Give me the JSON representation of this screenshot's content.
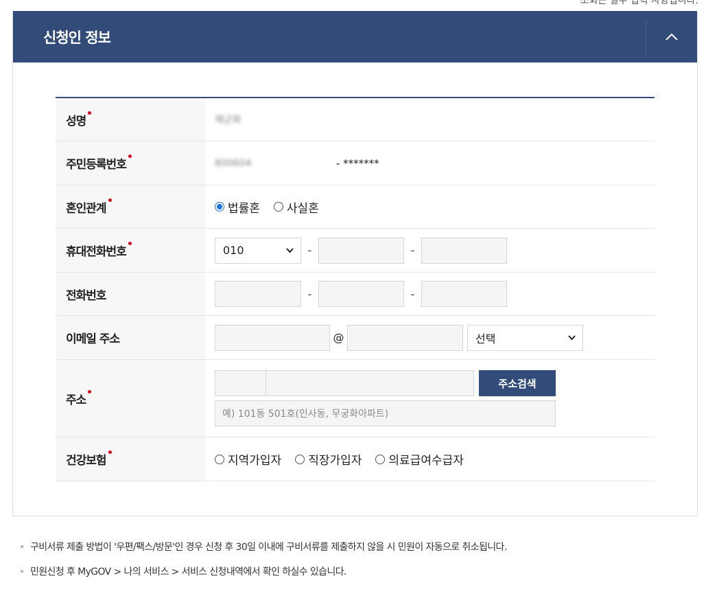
{
  "top_note": "조회는 필수 입력 사항입니다.",
  "section": {
    "title": "신청인 정보"
  },
  "fields": {
    "name": {
      "label": "성명",
      "value": "채군화"
    },
    "rrn": {
      "label": "주민등록번호",
      "front": "800604",
      "back": "- *******"
    },
    "marriage": {
      "label": "혼인관계",
      "options": [
        "법률혼",
        "사실혼"
      ],
      "selected": "법률혼"
    },
    "mobile": {
      "label": "휴대전화번호",
      "prefix": "010"
    },
    "phone": {
      "label": "전화번호"
    },
    "email": {
      "label": "이메일 주소",
      "at": "@",
      "domain_select": "선택"
    },
    "address": {
      "label": "주소",
      "search_button": "주소검색",
      "detail_placeholder": "예) 101동 501호(인사동, 무궁화아파트)"
    },
    "insurance": {
      "label": "건강보험",
      "options": [
        "지역가입자",
        "직장가입자",
        "의료급여수급자"
      ],
      "selected": null
    }
  },
  "notes": [
    "구비서류 제출 방법이 '우편/팩스/방문'인 경우 신청 후 30일 이내에 구비서류를 제출하지 않을 시 민원이 자동으로 취소됩니다.",
    "민원신청 후 MyGOV > 나의 서비스 > 서비스 신청내역에서 확인 하실수 있습니다."
  ],
  "colors": {
    "header_bg": "#334b78",
    "required_dot": "#e60012",
    "radio_checked": "#1a73e8"
  },
  "icons": {
    "collapse": "chevron-up-icon",
    "select_arrow": "chevron-down-icon"
  }
}
